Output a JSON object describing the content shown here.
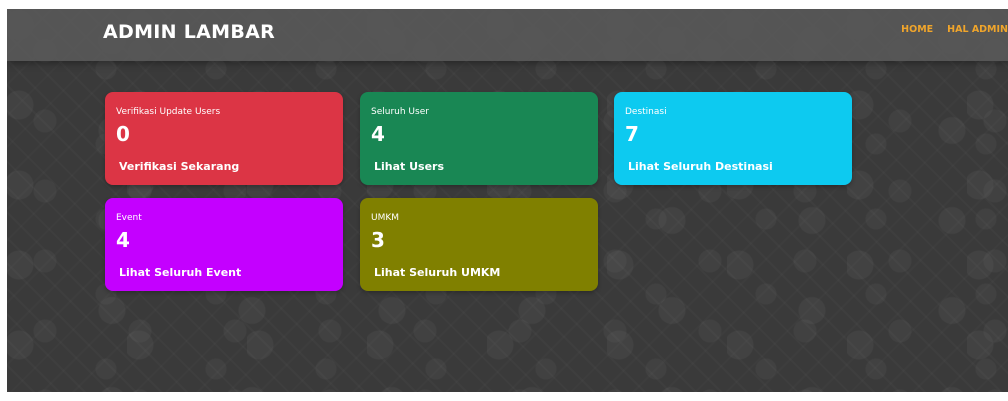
{
  "navbar": {
    "brand": "ADMIN LAMBAR",
    "links": [
      {
        "label": "HOME"
      },
      {
        "label": "HAL ADMIN"
      }
    ]
  },
  "colors": {
    "navbar_link": "#f0a52b",
    "card_verifikasi": "#dc3545",
    "card_users": "#198754",
    "card_destinasi": "#0dcaf0",
    "card_event": "#c400ff",
    "card_umkm": "#808000"
  },
  "cards": [
    {
      "label": "Verifikasi Update Users",
      "value": "0",
      "link": "Verifikasi Sekarang"
    },
    {
      "label": "Seluruh User",
      "value": "4",
      "link": "Lihat Users"
    },
    {
      "label": "Destinasi",
      "value": "7",
      "link": "Lihat Seluruh Destinasi"
    },
    {
      "label": "Event",
      "value": "4",
      "link": "Lihat Seluruh Event"
    },
    {
      "label": "UMKM",
      "value": "3",
      "link": "Lihat Seluruh UMKM"
    }
  ]
}
